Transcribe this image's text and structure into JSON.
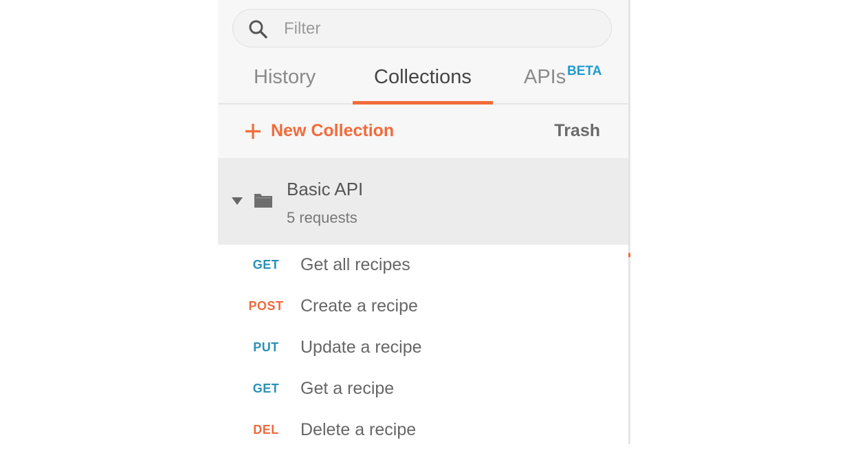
{
  "search": {
    "placeholder": "Filter"
  },
  "tabs": [
    {
      "label": "History",
      "active": false
    },
    {
      "label": "Collections",
      "active": true
    },
    {
      "label": "APIs",
      "badge": "BETA",
      "active": false
    }
  ],
  "actions": {
    "new_collection_label": "New Collection",
    "trash_label": "Trash"
  },
  "collection": {
    "name": "Basic API",
    "count_label": "5 requests",
    "expanded": true
  },
  "requests": [
    {
      "method": "GET",
      "name": "Get all recipes"
    },
    {
      "method": "POST",
      "name": "Create a recipe"
    },
    {
      "method": "PUT",
      "name": "Update a recipe"
    },
    {
      "method": "GET",
      "name": "Get a recipe"
    },
    {
      "method": "DEL",
      "name": "Delete a recipe"
    }
  ],
  "colors": {
    "accent": "#f26b3a",
    "get_put": "#2a91b5",
    "post_del": "#ef6a3c",
    "beta": "#1f9bd0"
  },
  "icons": {
    "search": "search-icon",
    "plus": "plus-icon",
    "caret": "caret-down-icon",
    "folder": "folder-icon"
  }
}
